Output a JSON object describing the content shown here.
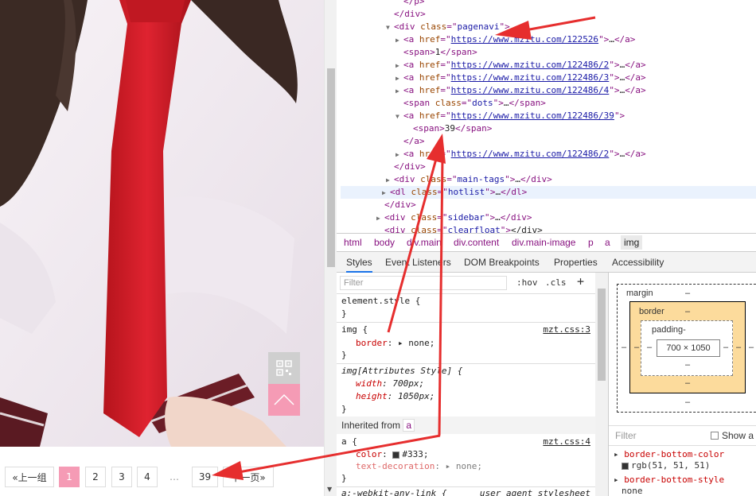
{
  "pagenavi": {
    "prev_group": "«上一组",
    "pages": [
      "1",
      "2",
      "3",
      "4"
    ],
    "current": "1",
    "dots": "…",
    "last": "39",
    "next_page": "下一页»"
  },
  "elements": {
    "lines": [
      {
        "indent": 5,
        "tw": "",
        "parts": [
          [
            "tag",
            "</p>"
          ]
        ]
      },
      {
        "indent": 4,
        "tw": "",
        "parts": [
          [
            "tag",
            "</div>"
          ]
        ]
      },
      {
        "indent": 4,
        "tw": "▼",
        "parts": [
          [
            "tag",
            "<div "
          ],
          [
            "at",
            "class"
          ],
          [
            "tag",
            "=\""
          ],
          [
            "av",
            "pagenavi"
          ],
          [
            "tag",
            "\">"
          ]
        ]
      },
      {
        "indent": 5,
        "tw": "▶",
        "parts": [
          [
            "tag",
            "<a "
          ],
          [
            "at",
            "href"
          ],
          [
            "tag",
            "=\""
          ],
          [
            "lk",
            "https://www.mzitu.com/122526"
          ],
          [
            "tag",
            "\">"
          ],
          [
            "tx",
            "…"
          ],
          [
            "tag",
            "</a>"
          ]
        ]
      },
      {
        "indent": 5,
        "tw": "",
        "parts": [
          [
            "tag",
            "<span>"
          ],
          [
            "tx",
            "1"
          ],
          [
            "tag",
            "</span>"
          ]
        ]
      },
      {
        "indent": 5,
        "tw": "▶",
        "parts": [
          [
            "tag",
            "<a "
          ],
          [
            "at",
            "href"
          ],
          [
            "tag",
            "=\""
          ],
          [
            "lk",
            "https://www.mzitu.com/122486/2"
          ],
          [
            "tag",
            "\">"
          ],
          [
            "tx",
            "…"
          ],
          [
            "tag",
            "</a>"
          ]
        ]
      },
      {
        "indent": 5,
        "tw": "▶",
        "parts": [
          [
            "tag",
            "<a "
          ],
          [
            "at",
            "href"
          ],
          [
            "tag",
            "=\""
          ],
          [
            "lk",
            "https://www.mzitu.com/122486/3"
          ],
          [
            "tag",
            "\">"
          ],
          [
            "tx",
            "…"
          ],
          [
            "tag",
            "</a>"
          ]
        ]
      },
      {
        "indent": 5,
        "tw": "▶",
        "parts": [
          [
            "tag",
            "<a "
          ],
          [
            "at",
            "href"
          ],
          [
            "tag",
            "=\""
          ],
          [
            "lk",
            "https://www.mzitu.com/122486/4"
          ],
          [
            "tag",
            "\">"
          ],
          [
            "tx",
            "…"
          ],
          [
            "tag",
            "</a>"
          ]
        ]
      },
      {
        "indent": 5,
        "tw": "",
        "parts": [
          [
            "tag",
            "<span "
          ],
          [
            "at",
            "class"
          ],
          [
            "tag",
            "=\""
          ],
          [
            "av",
            "dots"
          ],
          [
            "tag",
            "\">"
          ],
          [
            "tx",
            "…"
          ],
          [
            "tag",
            "</span>"
          ]
        ]
      },
      {
        "indent": 5,
        "tw": "▼",
        "parts": [
          [
            "tag",
            "<a "
          ],
          [
            "at",
            "href"
          ],
          [
            "tag",
            "=\""
          ],
          [
            "lk",
            "https://www.mzitu.com/122486/39"
          ],
          [
            "tag",
            "\">"
          ]
        ]
      },
      {
        "indent": 6,
        "tw": "",
        "parts": [
          [
            "tag",
            "<span>"
          ],
          [
            "tx",
            "39"
          ],
          [
            "tag",
            "</span>"
          ]
        ]
      },
      {
        "indent": 5,
        "tw": "",
        "parts": [
          [
            "tag",
            "</a>"
          ]
        ]
      },
      {
        "indent": 5,
        "tw": "▶",
        "parts": [
          [
            "tag",
            "<a "
          ],
          [
            "at",
            "href"
          ],
          [
            "tag",
            "=\""
          ],
          [
            "lk",
            "https://www.mzitu.com/122486/2"
          ],
          [
            "tag",
            "\">"
          ],
          [
            "tx",
            "…"
          ],
          [
            "tag",
            "</a>"
          ]
        ]
      },
      {
        "indent": 4,
        "tw": "",
        "parts": [
          [
            "tag",
            "</div>"
          ]
        ]
      },
      {
        "indent": 4,
        "tw": "▶",
        "parts": [
          [
            "tag",
            "<div "
          ],
          [
            "at",
            "class"
          ],
          [
            "tag",
            "=\""
          ],
          [
            "av",
            "main-tags"
          ],
          [
            "tag",
            "\">"
          ],
          [
            "tx",
            "…"
          ],
          [
            "tag",
            "</div>"
          ]
        ]
      },
      {
        "indent": 4,
        "tw": "▶",
        "sel": true,
        "parts": [
          [
            "tag",
            "<dl "
          ],
          [
            "at",
            "class"
          ],
          [
            "tag",
            "=\""
          ],
          [
            "av",
            "hotlist"
          ],
          [
            "tag",
            "\">"
          ],
          [
            "tx",
            "…"
          ],
          [
            "tag",
            "</dl>"
          ]
        ]
      },
      {
        "indent": 3,
        "tw": "",
        "parts": [
          [
            "tag",
            "</div>"
          ]
        ]
      },
      {
        "indent": 3,
        "tw": "▶",
        "parts": [
          [
            "tag",
            "<div "
          ],
          [
            "at",
            "class"
          ],
          [
            "tag",
            "=\""
          ],
          [
            "av",
            "sidebar"
          ],
          [
            "tag",
            "\">"
          ],
          [
            "tx",
            "…"
          ],
          [
            "tag",
            "</div>"
          ]
        ]
      },
      {
        "indent": 3,
        "tw": "",
        "parts": [
          [
            "tag",
            "<div "
          ],
          [
            "at",
            "class"
          ],
          [
            "tag",
            "=\""
          ],
          [
            "av",
            "clearfloat"
          ],
          [
            "tag",
            "\">"
          ],
          [
            "tx",
            "</div>"
          ]
        ]
      }
    ]
  },
  "breadcrumbs": [
    "html",
    "body",
    "div.main",
    "div.content",
    "div.main-image",
    "p",
    "a",
    "img"
  ],
  "tabs": [
    "Styles",
    "Event Listeners",
    "DOM Breakpoints",
    "Properties",
    "Accessibility"
  ],
  "styles": {
    "filter_placeholder": "Filter",
    "hov": ":hov",
    "cls": ".cls",
    "plus": "+",
    "element_style": "element.style {",
    "close_brace": "}",
    "img_selector": "img {",
    "img_src": "mzt.css:3",
    "img_prop": "border",
    "img_val": "none;",
    "attr_selector": "img[Attributes Style] {",
    "width_prop": "width",
    "width_val": "700px;",
    "height_prop": "height",
    "height_val": "1050px;",
    "inherited_label": "Inherited from",
    "inherited_tag": "a",
    "a_selector": "a {",
    "a_src": "mzt.css:4",
    "color_prop": "color",
    "color_val": "#333;",
    "textdec_prop": "text-decoration",
    "textdec_val": "none;",
    "webkit_selector": "a:-webkit-any-link {",
    "ua_label": "user agent stylesheet"
  },
  "boxmodel": {
    "margin_label": "margin",
    "border_label": "border",
    "padding_label": "padding-",
    "dash": "–",
    "content_size": "700 × 1050",
    "filter_label": "Filter",
    "show_all": "Show a",
    "computed": [
      {
        "name": "border-bottom-color",
        "value": "rgb(51, 51, 51)",
        "swatch": "#333333"
      },
      {
        "name": "border-bottom-style",
        "value": "none"
      }
    ]
  },
  "colors": {
    "accent_pink": "#f59bb5",
    "annotation_red": "#e62e2e"
  }
}
